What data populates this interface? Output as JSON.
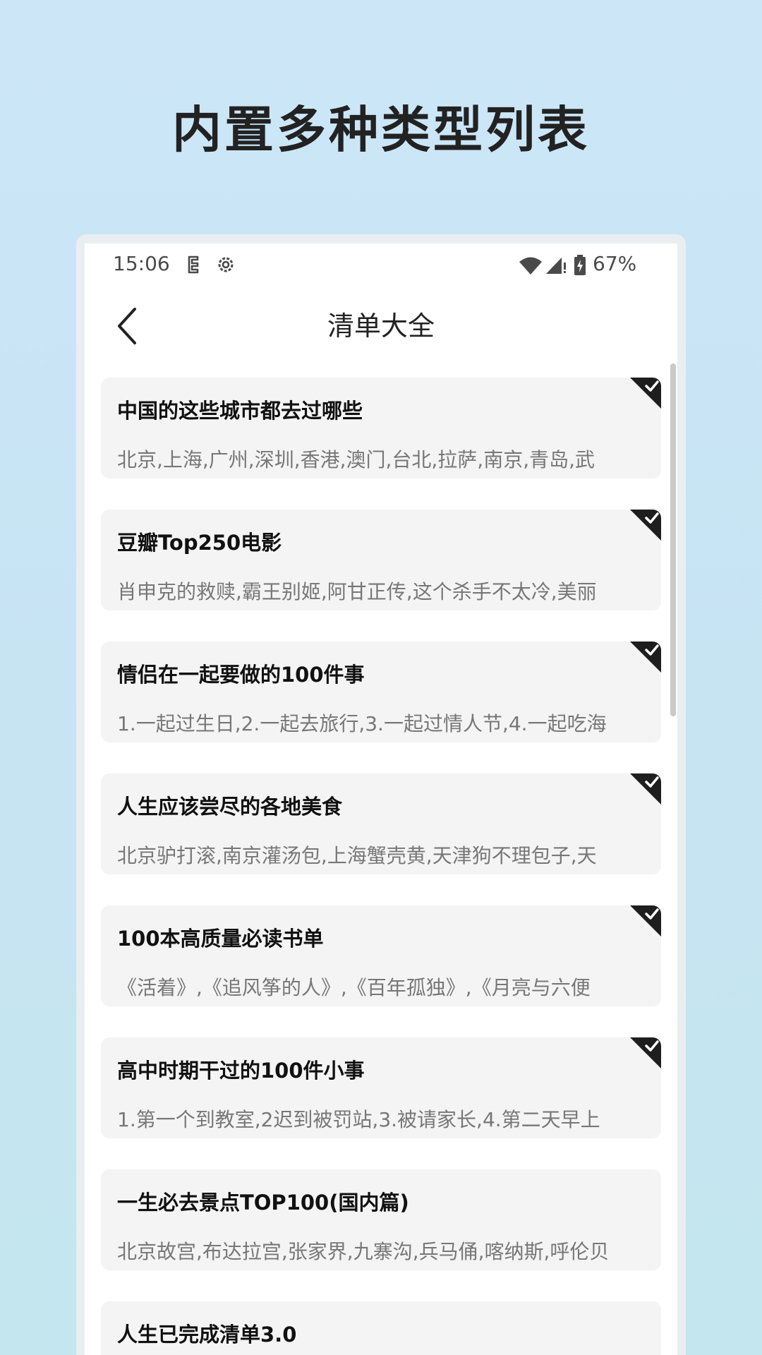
{
  "promo": {
    "title": "内置多种类型列表"
  },
  "status_bar": {
    "time": "15:06",
    "battery": "67%",
    "icons": [
      "notification-icon",
      "settings-icon",
      "wifi-icon",
      "signal-icon",
      "battery-icon"
    ]
  },
  "toolbar": {
    "back_icon": "chevron-left-icon",
    "title": "清单大全"
  },
  "list": {
    "items": [
      {
        "title": "中国的这些城市都去过哪些",
        "desc": "北京,上海,广州,深圳,香港,澳门,台北,拉萨,南京,青岛,武",
        "done": true
      },
      {
        "title": "豆瓣Top250电影",
        "desc": "肖申克的救赎,霸王别姬,阿甘正传,这个杀手不太冷,美丽",
        "done": true
      },
      {
        "title": "情侣在一起要做的100件事",
        "desc": "1.一起过生日,2.一起去旅行,3.一起过情人节,4.一起吃海",
        "done": true
      },
      {
        "title": "人生应该尝尽的各地美食",
        "desc": "北京驴打滚,南京灌汤包,上海蟹壳黄,天津狗不理包子,天",
        "done": true
      },
      {
        "title": "100本高质量必读书单",
        "desc": "《活着》,《追风筝的人》,《百年孤独》,《月亮与六便",
        "done": true
      },
      {
        "title": "高中时期干过的100件小事",
        "desc": "1.第一个到教室,2迟到被罚站,3.被请家长,4.第二天早上",
        "done": true
      },
      {
        "title": "一生必去景点TOP100(国内篇)",
        "desc": "北京故宫,布达拉宫,张家界,九寨沟,兵马俑,喀纳斯,呼伦贝",
        "done": false
      },
      {
        "title": "人生已完成清单3.0",
        "desc": "",
        "done": false
      }
    ]
  },
  "colors": {
    "background": "#cce6f8",
    "card": "#f4f4f4",
    "done_badge": "#1e1e1e",
    "title_text": "#111111",
    "desc_text": "#777777"
  }
}
